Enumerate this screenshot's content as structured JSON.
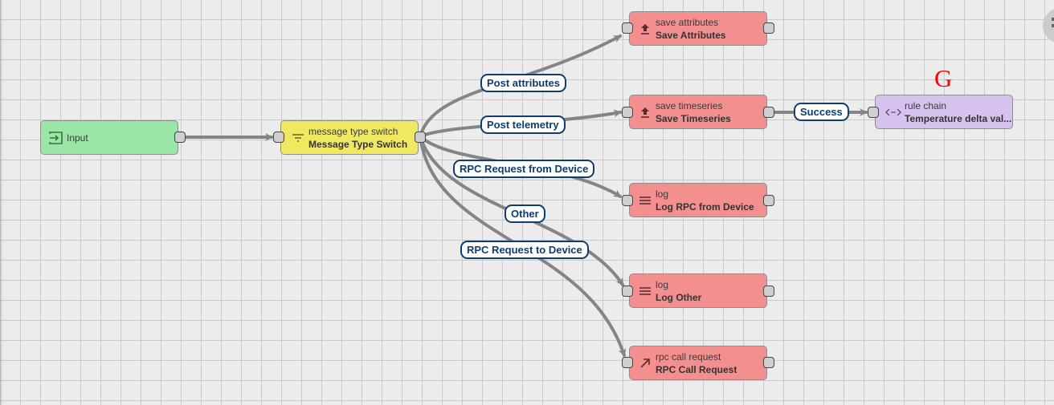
{
  "canvas": {
    "grid": true,
    "background_color": "#ececec",
    "edge_color": "#858585",
    "label_border_color": "#0f3d6e"
  },
  "nodes": {
    "input": {
      "type": "",
      "name": "Input",
      "icon": "input-icon",
      "color": "#9ae6a7"
    },
    "switch": {
      "type": "message type switch",
      "name": "Message Type Switch",
      "icon": "filter-icon",
      "color": "#f1e861"
    },
    "save_attributes": {
      "type": "save attributes",
      "name": "Save Attributes",
      "icon": "upload-icon",
      "color": "#f38f8f"
    },
    "save_timeseries": {
      "type": "save timeseries",
      "name": "Save Timeseries",
      "icon": "upload-icon",
      "color": "#f38f8f"
    },
    "rule_chain": {
      "type": "rule chain",
      "name": "Temperature delta val...",
      "icon": "code-brackets-icon",
      "color": "#d6c2ee"
    },
    "log_rpc": {
      "type": "log",
      "name": "Log RPC from Device",
      "icon": "menu-lines-icon",
      "color": "#f38f8f"
    },
    "log_other": {
      "type": "log",
      "name": "Log Other",
      "icon": "menu-lines-icon",
      "color": "#f38f8f"
    },
    "rpc_call": {
      "type": "rpc call request",
      "name": "RPC Call Request",
      "icon": "arrow-up-right-icon",
      "color": "#f38f8f"
    }
  },
  "edges": [
    {
      "from": "input",
      "to": "switch",
      "label": ""
    },
    {
      "from": "switch",
      "to": "save_attributes",
      "label": "Post attributes"
    },
    {
      "from": "switch",
      "to": "save_timeseries",
      "label": "Post telemetry"
    },
    {
      "from": "switch",
      "to": "log_rpc",
      "label": "RPC Request from Device"
    },
    {
      "from": "switch",
      "to": "log_other",
      "label": "Other"
    },
    {
      "from": "switch",
      "to": "rpc_call",
      "label": "RPC Request to Device"
    },
    {
      "from": "save_timeseries",
      "to": "rule_chain",
      "label": "Success"
    }
  ],
  "overlay": {
    "letter": "G"
  }
}
